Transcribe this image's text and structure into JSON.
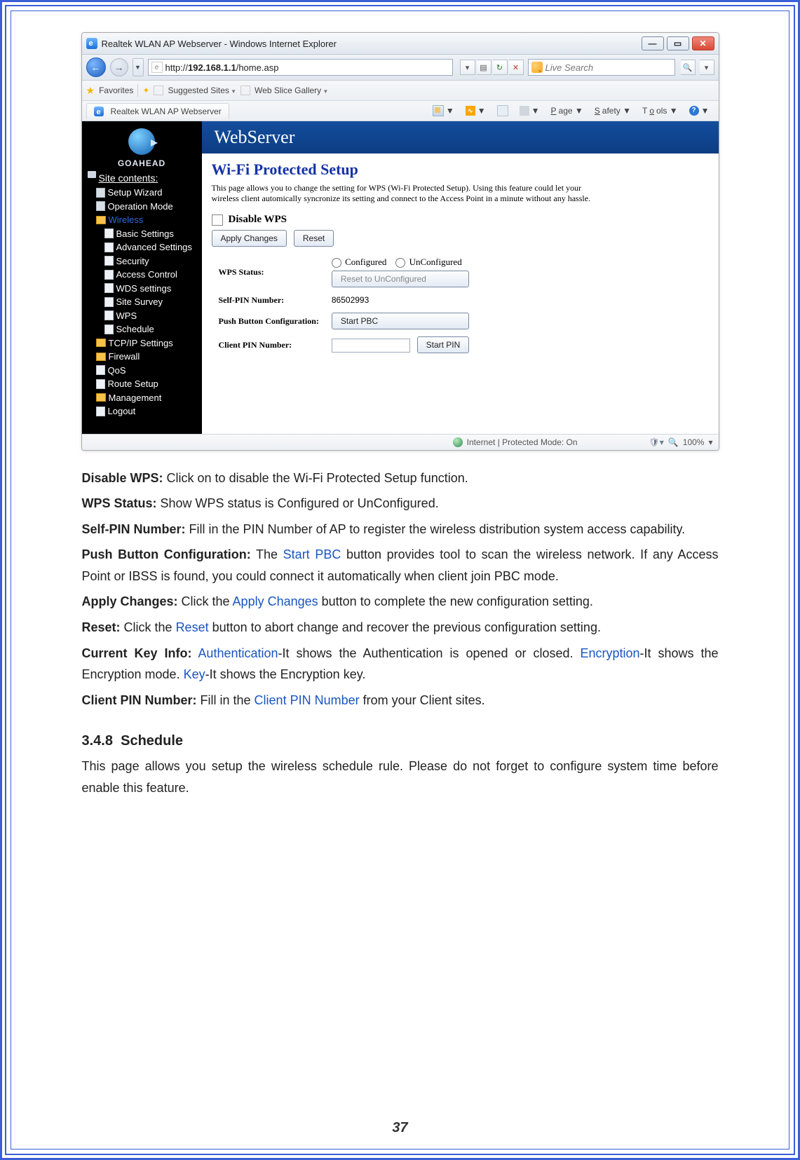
{
  "browser": {
    "title": "Realtek WLAN AP Webserver - Windows Internet Explorer",
    "url_host": "192.168.1.1",
    "url_path": "/home.asp",
    "url_scheme": "http://",
    "search_placeholder": "Live Search",
    "fav_label": "Favorites",
    "suggested": "Suggested Sites",
    "gallery": "Web Slice Gallery",
    "tab_title": "Realtek WLAN AP Webserver",
    "menu_page": "Page",
    "menu_safety": "Safety",
    "menu_tools": "Tools",
    "status_text": "Internet | Protected Mode: On",
    "zoom": "100%"
  },
  "logo": "GOAHEAD",
  "banner": "WebServer",
  "tree": {
    "header": "Site contents:",
    "setup": "Setup Wizard",
    "op": "Operation Mode",
    "wireless": "Wireless",
    "w_basic": "Basic Settings",
    "w_adv": "Advanced Settings",
    "w_sec": "Security",
    "w_ac": "Access Control",
    "w_wds": "WDS settings",
    "w_ss": "Site Survey",
    "w_wps": "WPS",
    "w_sch": "Schedule",
    "tcp": "TCP/IP Settings",
    "fw": "Firewall",
    "qos": "QoS",
    "route": "Route Setup",
    "mgmt": "Management",
    "logout": "Logout"
  },
  "page": {
    "heading": "Wi-Fi Protected Setup",
    "desc": "This page allows you to change the setting for WPS (Wi-Fi Protected Setup). Using this feature could let your wireless client automically syncronize its setting and connect to the Access Point in a minute without any hassle.",
    "disable": "Disable WPS",
    "apply": "Apply Changes",
    "reset": "Reset",
    "status_k": "WPS Status:",
    "status_conf": "Configured",
    "status_unconf": "UnConfigured",
    "reset_unconf": "Reset to UnConfigured",
    "selfpin_k": "Self-PIN Number:",
    "selfpin_v": "86502993",
    "pbc_k": "Push Button Configuration:",
    "pbc_btn": "Start PBC",
    "clientpin_k": "Client PIN Number:",
    "clientpin_btn": "Start PIN"
  },
  "copy": {
    "l1k": "Disable WPS:",
    "l1v": " Click on to disable the Wi-Fi Protected Setup function.",
    "l2k": "WPS Status:",
    "l2v": " Show WPS status is Configured or UnConfigured.",
    "l3k": "Self-PIN Number:",
    "l3v": " Fill in the PIN Number of AP to register the wireless distribution system access capability.",
    "l4k": "Push Button Configuration:",
    "l4a": " The ",
    "l4b": "Start PBC",
    "l4c": " button provides tool to scan the wireless network. If any Access Point or IBSS is found, you could connect it automatically when client join PBC mode.",
    "l5k": "Apply Changes:",
    "l5a": " Click the ",
    "l5b": "Apply Changes",
    "l5c": " button to complete the new configuration setting.",
    "l6k": "Reset:",
    "l6a": " Click the ",
    "l6b": "Reset",
    "l6c": " button to abort change and recover the previous configuration setting.",
    "l7k": "Current Key Info:",
    "l7a": " ",
    "l7b": "Authentication",
    "l7c": "-It shows the Authentication is opened or closed. ",
    "l7d": "Encryption",
    "l7e": "-It shows the Encryption mode. ",
    "l7f": "Key",
    "l7g": "-It shows the Encryption key.",
    "l8k": "Client PIN Number:",
    "l8a": " Fill in the ",
    "l8b": "Client PIN Number",
    "l8c": " from your Client sites.",
    "sect_no": "3.4.8",
    "sect_ti": "Schedule",
    "sect_p": "This page allows you setup the wireless schedule rule. Please do not forget to configure system time before enable this feature."
  },
  "page_number": "37"
}
